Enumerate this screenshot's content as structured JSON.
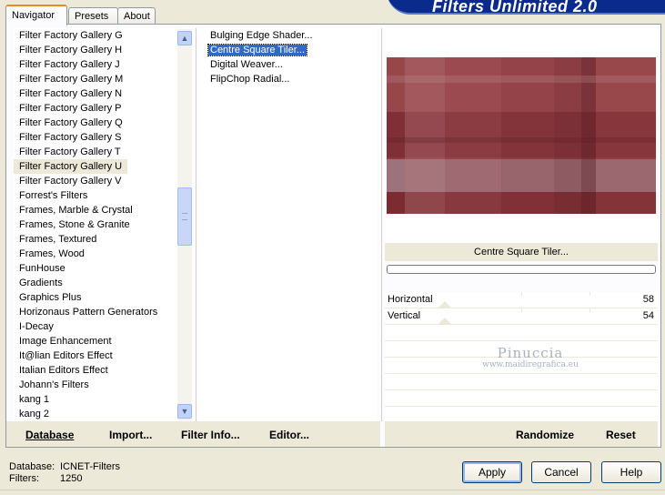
{
  "tabs": [
    {
      "label": "Navigator"
    },
    {
      "label": "Presets"
    },
    {
      "label": "About"
    }
  ],
  "banner_title": "Filters Unlimited 2.0",
  "categories": [
    "Filter Factory Gallery G",
    "Filter Factory Gallery H",
    "Filter Factory Gallery J",
    "Filter Factory Gallery M",
    "Filter Factory Gallery N",
    "Filter Factory Gallery P",
    "Filter Factory Gallery Q",
    "Filter Factory Gallery S",
    "Filter Factory Gallery T",
    "Filter Factory Gallery U",
    "Filter Factory Gallery V",
    "Forrest's Filters",
    "Frames, Marble & Crystal",
    "Frames, Stone & Granite",
    "Frames, Textured",
    "Frames, Wood",
    "FunHouse",
    "Gradients",
    "Graphics Plus",
    "Horizonaus Pattern Generators",
    "I-Decay",
    "Image Enhancement",
    "It@lian Editors Effect",
    "Italian Editors Effect",
    "Johann's Filters",
    "kang 1",
    "kang 2"
  ],
  "selected_category": "Filter Factory Gallery U",
  "filters": [
    "Bulging Edge Shader...",
    "Centre Square Tiler...",
    "Digital Weaver...",
    "FlipChop Radial..."
  ],
  "selected_filter": "Centre Square Tiler...",
  "left_buttons": {
    "database": "Database",
    "import": "Import...",
    "filter_info": "Filter Info...",
    "editor": "Editor..."
  },
  "preview_filter_name": "Centre Square Tiler...",
  "params": [
    {
      "label": "Horizontal",
      "value": "58"
    },
    {
      "label": "Vertical",
      "value": "54"
    }
  ],
  "watermark": {
    "line1": "Pinuccia",
    "line2": "www.maidiregrafica.eu"
  },
  "right_buttons": {
    "randomize": "Randomize",
    "reset": "Reset"
  },
  "footer": {
    "database_label": "Database:",
    "database_value": "ICNET-Filters",
    "filters_label": "Filters:",
    "filters_value": "1250"
  },
  "dialog_buttons": {
    "apply": "Apply",
    "cancel": "Cancel",
    "help": "Help"
  },
  "colors": {
    "selection": "#316ac5",
    "preview_base": "#8f3a3f",
    "banner": "#0a2a8c"
  }
}
